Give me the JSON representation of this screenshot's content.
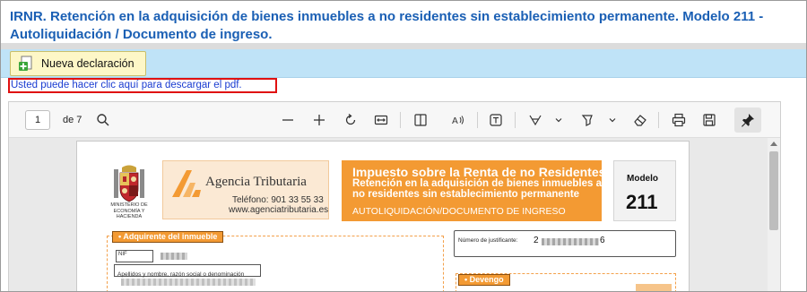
{
  "page": {
    "title": "IRNR. Retención en la adquisición de bienes inmuebles a no residentes sin establecimiento permanente. Modelo 211 - Autoliquidación / Documento de ingreso."
  },
  "toolbar": {
    "new_declaration_label": "Nueva declaración",
    "plus_icon": "add-document-icon"
  },
  "pdf_link": {
    "text": "Usted puede hacer clic aquí para descargar el pdf."
  },
  "viewer": {
    "current_page": "1",
    "page_count_label": "de 7",
    "icons": [
      "search-icon",
      "zoom-out-icon",
      "zoom-in-icon",
      "rotate-icon",
      "fit-width-icon",
      "page-view-icon",
      "read-aloud-icon",
      "text-icon",
      "draw-icon",
      "chevron-down-icon",
      "highlight-icon",
      "chevron-down-icon",
      "eraser-icon",
      "print-icon",
      "save-icon",
      "pin-icon"
    ]
  },
  "document": {
    "ministry_text": "MINISTERIO DE ECONOMÍA Y HACIENDA",
    "agency_name": "Agencia Tributaria",
    "agency_phone": "Teléfono: 901 33 55 33",
    "agency_web": "www.agenciatributaria.es",
    "tax_title": "Impuesto sobre la Renta de no Residentes.",
    "tax_sub1": "Retención en la adquisición de bienes inmuebles a",
    "tax_sub2": "no residentes sin establecimiento permanente",
    "tax_footer": "AUTOLIQUIDACIÓN/DOCUMENTO DE INGRESO",
    "model_label": "Modelo",
    "model_number": "211",
    "acquirer_section": "Adquirente del inmueble",
    "nif_label": "NIF",
    "name_label": "Apellidos y nombre, razón social o denominación",
    "justificante_label": "Número de justificante:",
    "justificante_start": "2",
    "justificante_end": "6",
    "devengo_section": "Devengo"
  },
  "colors": {
    "title_blue": "#1a5fb4",
    "info_bar": "#bfe3f7",
    "button_yellow": "#fdf7c7",
    "highlight_red": "#e01010",
    "aeat_orange": "#f39a33"
  }
}
